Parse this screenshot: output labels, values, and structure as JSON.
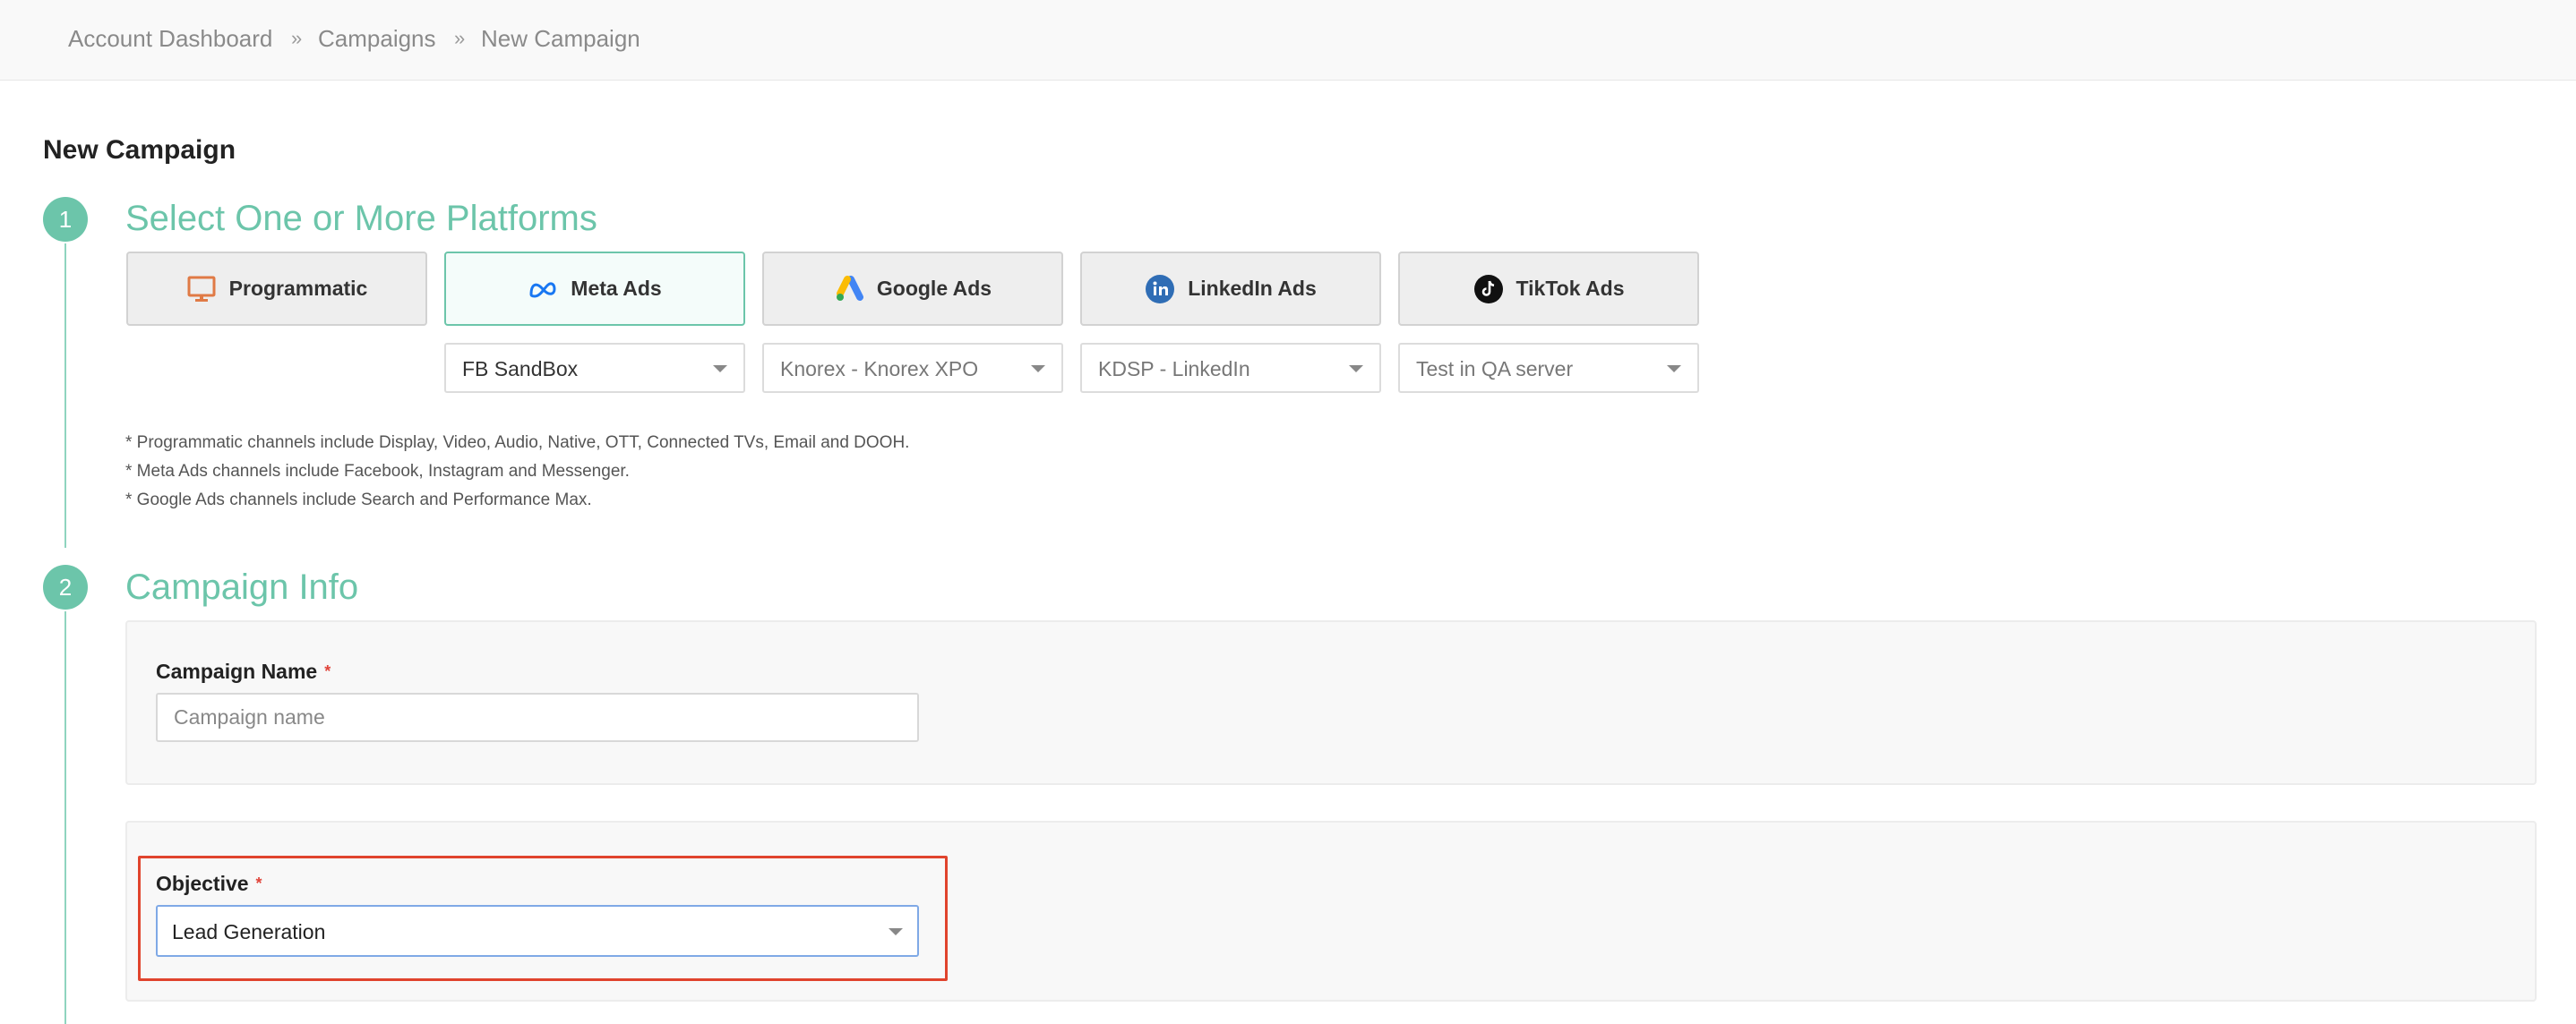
{
  "breadcrumb": {
    "items": [
      "Account Dashboard",
      "Campaigns",
      "New Campaign"
    ],
    "separator": "»"
  },
  "page": {
    "title": "New Campaign"
  },
  "steps": [
    {
      "number": "1",
      "title": "Select One or More Platforms"
    },
    {
      "number": "2",
      "title": "Campaign Info"
    }
  ],
  "platforms": [
    {
      "label": "Programmatic",
      "icon": "monitor-icon",
      "selected": false
    },
    {
      "label": "Meta Ads",
      "icon": "meta-logo-icon",
      "selected": true
    },
    {
      "label": "Google Ads",
      "icon": "google-ads-logo-icon",
      "selected": false
    },
    {
      "label": "LinkedIn Ads",
      "icon": "linkedin-logo-icon",
      "selected": false
    },
    {
      "label": "TikTok Ads",
      "icon": "tiktok-logo-icon",
      "selected": false
    }
  ],
  "platform_accounts": [
    {
      "platform": "Meta Ads",
      "value": "FB SandBox"
    },
    {
      "platform": "Google Ads",
      "value": "Knorex - Knorex XPO"
    },
    {
      "platform": "LinkedIn Ads",
      "value": "KDSP - LinkedIn"
    },
    {
      "platform": "TikTok Ads",
      "value": "Test in QA server"
    }
  ],
  "notes": [
    "* Programmatic channels include Display, Video, Audio, Native, OTT, Connected TVs, Email and DOOH.",
    "* Meta Ads channels include Facebook, Instagram and Messenger.",
    "* Google Ads channels include Search and Performance Max."
  ],
  "campaign_info": {
    "campaign_name": {
      "label": "Campaign Name",
      "required_mark": "*",
      "placeholder": "Campaign name",
      "value": ""
    },
    "objective": {
      "label": "Objective",
      "required_mark": "*",
      "value": "Lead Generation"
    }
  },
  "colors": {
    "accent": "#6cc5aa",
    "required": "#e0443a",
    "highlight": "#e0442d",
    "focus_border": "#7fa9e6"
  }
}
